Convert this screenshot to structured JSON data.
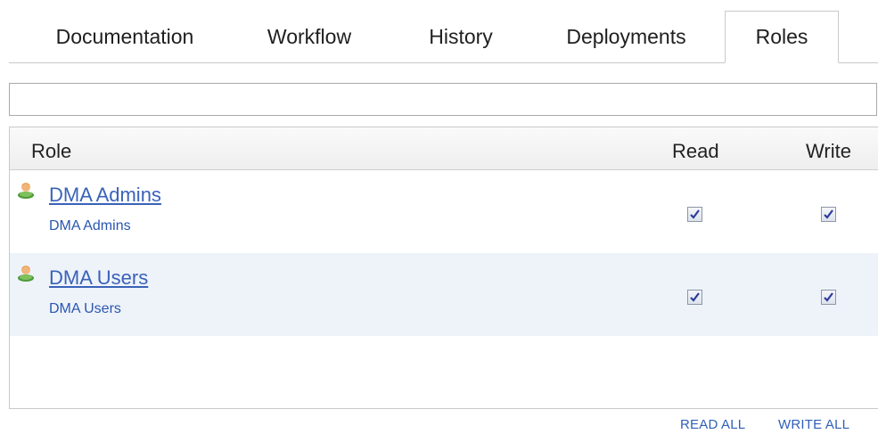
{
  "tabs": [
    {
      "label": "Documentation",
      "active": false
    },
    {
      "label": "Workflow",
      "active": false
    },
    {
      "label": "History",
      "active": false
    },
    {
      "label": "Deployments",
      "active": false
    },
    {
      "label": "Roles",
      "active": true
    }
  ],
  "filter": {
    "value": "",
    "placeholder": ""
  },
  "table": {
    "columns": {
      "role": "Role",
      "read": "Read",
      "write": "Write"
    },
    "rows": [
      {
        "name": "DMA Admins",
        "description": "DMA Admins",
        "read": true,
        "write": true,
        "icon": "user-role-icon"
      },
      {
        "name": "DMA Users",
        "description": "DMA Users",
        "read": true,
        "write": true,
        "icon": "user-role-icon"
      }
    ]
  },
  "footer": {
    "read_all": "READ ALL",
    "write_all": "WRITE ALL"
  },
  "colors": {
    "link": "#3a62b8",
    "alt_row": "#eef3fa",
    "border": "#c9c9c9"
  }
}
